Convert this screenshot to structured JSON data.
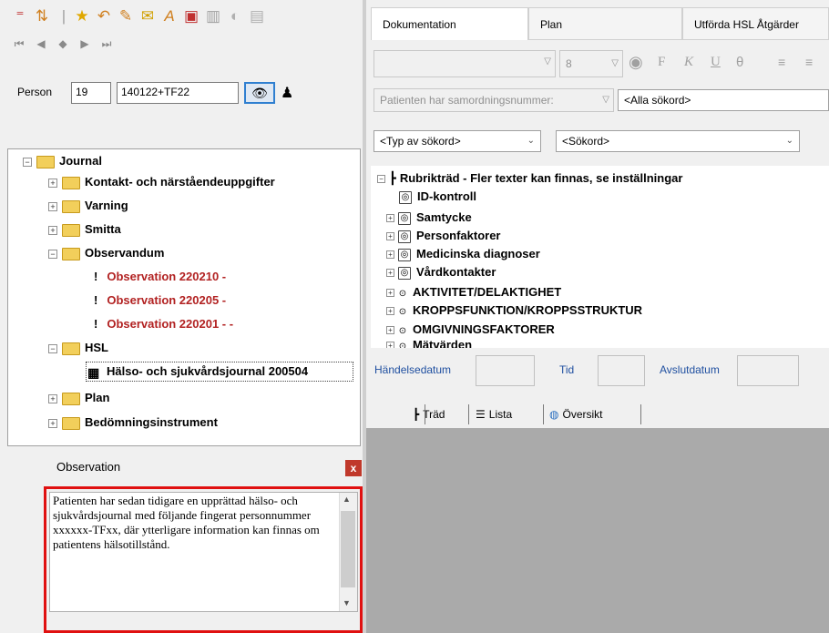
{
  "left": {
    "person": {
      "label": "Person",
      "number": "19",
      "id": "140122+TF22"
    },
    "tree": {
      "journal": "Journal",
      "kontakt": "Kontakt- och närståendeuppgifter",
      "varning": "Varning",
      "smitta": "Smitta",
      "observandum": "Observandum",
      "observations": [
        "Observation 220210 -",
        "Observation 220205 -",
        "Observation 220201 - -"
      ],
      "hsl": "HSL",
      "hsl_journal": "Hälso- och sjukvårdsjournal 200504",
      "plan": "Plan",
      "bedomning": "Bedömningsinstrument",
      "expand_symbol": "+",
      "collapse_symbol": "−",
      "bang": "!"
    },
    "observation_panel": {
      "title": "Observation",
      "close": "x",
      "text": "Patienten har sedan tidigare en upprättad hälso- och sjukvårdsjournal med följande fingerat personnummer xxxxxx-TFxx, där ytterligare information kan finnas om patientens hälsotillstånd."
    }
  },
  "right": {
    "tabs": {
      "doc": "Dokumentation",
      "plan": "Plan",
      "hsl": "Utförda HSL Åtgärder"
    },
    "format": {
      "size": "8",
      "bold": "F",
      "italic": "K",
      "underline": "U",
      "strike": "θ"
    },
    "filters": {
      "samordning": "Patienten har samordningsnummer:",
      "alla": "<Alla sökord>",
      "typ": "<Typ av sökord>",
      "sokord": "<Sökord>"
    },
    "rtree": {
      "root": "Rubrikträd - Fler texter kan finnas, se inställningar",
      "items": [
        "ID-kontroll",
        "Samtycke",
        "Personfaktorer",
        "Medicinska diagnoser",
        "Vårdkontakter"
      ],
      "groups": [
        "AKTIVITET/DELAKTIGHET",
        "KROPPSFUNKTION/KROPPSSTRUKTUR",
        "OMGIVNINGSFAKTORER"
      ],
      "partial": "Mätvärden"
    },
    "dates": {
      "handelse": "Händelsedatum",
      "tid": "Tid",
      "avslut": "Avslutdatum"
    },
    "views": {
      "trad": "Träd",
      "lista": "Lista",
      "oversikt": "Översikt"
    }
  },
  "colors": {
    "observation_text": "#b22222",
    "highlight_border": "#e01010",
    "folder": "#f2cf5b",
    "link_label": "#1f4fa0"
  }
}
